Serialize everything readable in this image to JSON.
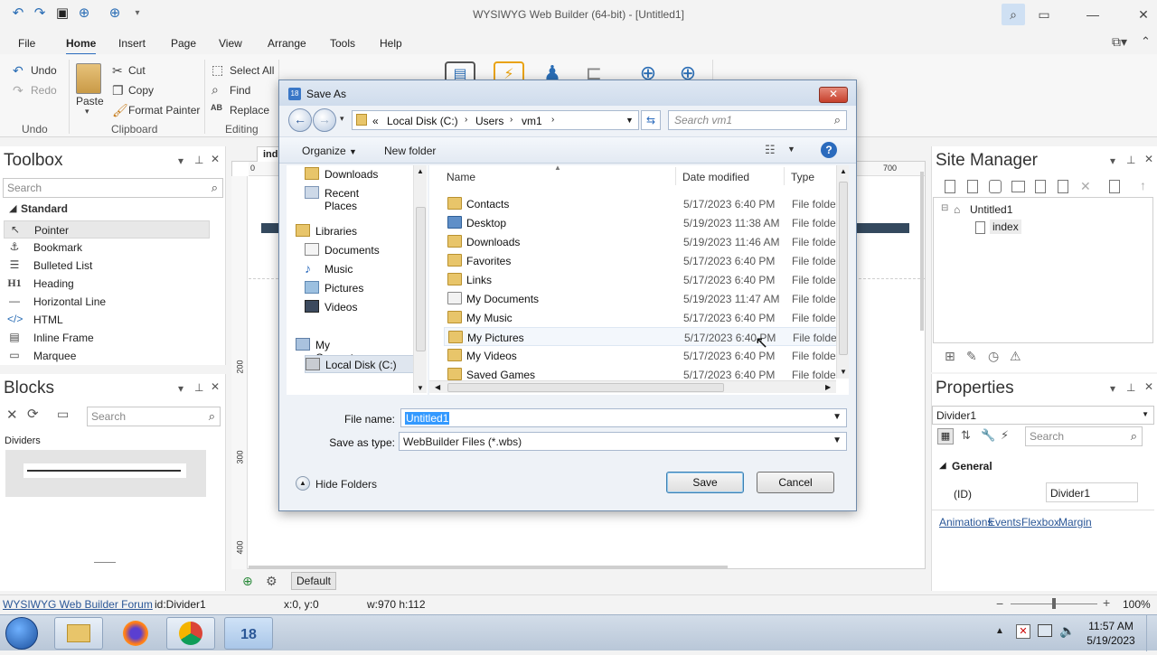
{
  "app": {
    "title": "WYSIWYG Web Builder (64-bit) - [Untitled1]"
  },
  "menu": [
    "File",
    "Home",
    "Insert",
    "Page",
    "View",
    "Arrange",
    "Tools",
    "Help"
  ],
  "ribbon": {
    "undo": "Undo",
    "redo": "Redo",
    "undo_group": "Undo",
    "paste": "Paste",
    "cut": "Cut",
    "copy": "Copy",
    "format_painter": "Format Painter",
    "clipboard_group": "Clipboard",
    "select_all": "Select All",
    "find": "Find",
    "replace": "Replace",
    "editing_group": "Editing"
  },
  "toolbox": {
    "title": "Toolbox",
    "search_placeholder": "Search",
    "section": "Standard",
    "items": [
      "Pointer",
      "Bookmark",
      "Bulleted List",
      "Heading",
      "Horizontal Line",
      "HTML",
      "Inline Frame",
      "Marquee"
    ]
  },
  "blocks": {
    "title": "Blocks",
    "search_placeholder": "Search",
    "category": "Dividers"
  },
  "canvas": {
    "tab_label": "ind",
    "ruler_h": [
      "0",
      "700"
    ],
    "ruler_v": [
      "200",
      "300",
      "400"
    ],
    "page_button": "Default"
  },
  "dialog": {
    "title": "Save As",
    "address": [
      "Local Disk (C:)",
      "Users",
      "vm1"
    ],
    "address_prefix": "«",
    "search_placeholder": "Search vm1",
    "organize": "Organize",
    "new_folder": "New folder",
    "nav": [
      {
        "label": "Downloads",
        "indent": 1
      },
      {
        "label": "Recent Places",
        "indent": 1
      },
      {
        "label": "Libraries",
        "indent": 0
      },
      {
        "label": "Documents",
        "indent": 1
      },
      {
        "label": "Music",
        "indent": 1
      },
      {
        "label": "Pictures",
        "indent": 1
      },
      {
        "label": "Videos",
        "indent": 1
      },
      {
        "label": "My Computer",
        "indent": 0
      },
      {
        "label": "Local Disk (C:)",
        "indent": 1
      }
    ],
    "columns": {
      "name": "Name",
      "date": "Date modified",
      "type": "Type"
    },
    "files": [
      {
        "name": "Contacts",
        "date": "5/17/2023 6:40 PM",
        "type": "File folder"
      },
      {
        "name": "Desktop",
        "date": "5/19/2023 11:38 AM",
        "type": "File folder"
      },
      {
        "name": "Downloads",
        "date": "5/19/2023 11:46 AM",
        "type": "File folder"
      },
      {
        "name": "Favorites",
        "date": "5/17/2023 6:40 PM",
        "type": "File folder"
      },
      {
        "name": "Links",
        "date": "5/17/2023 6:40 PM",
        "type": "File folder"
      },
      {
        "name": "My Documents",
        "date": "5/19/2023 11:47 AM",
        "type": "File folder"
      },
      {
        "name": "My Music",
        "date": "5/17/2023 6:40 PM",
        "type": "File folder"
      },
      {
        "name": "My Pictures",
        "date": "5/17/2023 6:40 PM",
        "type": "File folder"
      },
      {
        "name": "My Videos",
        "date": "5/17/2023 6:40 PM",
        "type": "File folder"
      },
      {
        "name": "Saved Games",
        "date": "5/17/2023 6:40 PM",
        "type": "File folder"
      }
    ],
    "file_name_label": "File name:",
    "file_name_value": "Untitled1",
    "save_type_label": "Save as type:",
    "save_type_value": "WebBuilder Files (*.wbs)",
    "hide_folders": "Hide Folders",
    "save": "Save",
    "cancel": "Cancel"
  },
  "site_manager": {
    "title": "Site Manager",
    "tree_root": "Untitled1",
    "tree_child": "index"
  },
  "properties": {
    "title": "Properties",
    "selected": "Divider1",
    "search_placeholder": "Search",
    "section": "General",
    "id_label": "(ID)",
    "id_value": "Divider1",
    "links": [
      "Animations",
      "Events",
      "Flexbox",
      "Margin"
    ]
  },
  "status": {
    "forum_link": "WYSIWYG Web Builder Forum",
    "id": "id:Divider1",
    "pos": "x:0, y:0",
    "size": "w:970 h:112",
    "zoom": "100%"
  },
  "taskbar": {
    "time": "11:57 AM",
    "date": "5/19/2023",
    "app_badge": "18"
  }
}
